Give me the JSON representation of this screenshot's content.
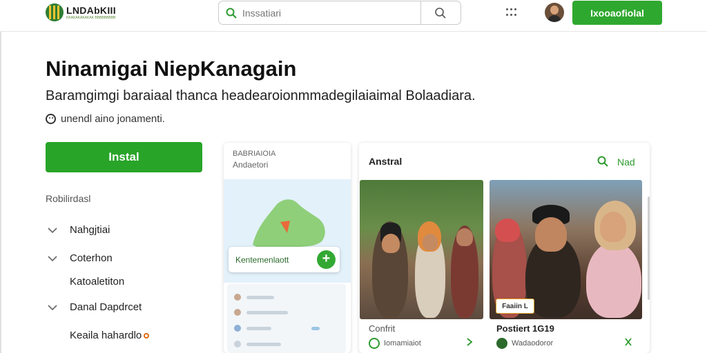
{
  "header": {
    "logo_title": "LNDAbKIII",
    "logo_sub": "KKAKAKAKAKAK BBBBBBBBB",
    "search_placeholder": "Inssatiari",
    "cta_label": "Ixooaofiolal",
    "icons": {
      "search": "search-icon",
      "apps": "apps-grid-icon",
      "avatar": "user-avatar"
    }
  },
  "hero": {
    "title": "Ninamigai NiepKanagain",
    "subtitle": "Baramgimgi baraiaal thanca headearoionmmadegilaiaimal Bolaadiara.",
    "note": "unendl aino jonamenti."
  },
  "install": {
    "label": "Instal"
  },
  "features": {
    "heading": "Robilirdasl",
    "items": [
      "Nahgjtiai",
      "Coterhon",
      "Katoaletiton",
      "Danal Dapdrcet",
      "Keaila hahardlo"
    ]
  },
  "map_card": {
    "head1": "BABRIAIOIA",
    "head2": "Andaetori",
    "toast_label": "Kentemenlaott",
    "toast_plus": "+"
  },
  "feed": {
    "title": "Anstral",
    "next_label": "Nad",
    "posts": [
      {
        "name": "Confrit",
        "meta": "Iomamiaiot"
      },
      {
        "name": "Postiert 1G19",
        "meta": "Wadaodoror",
        "tag": "Faaiin L"
      }
    ]
  },
  "colors": {
    "primary_green": "#2fa82f",
    "accent_orange": "#e06a12"
  }
}
